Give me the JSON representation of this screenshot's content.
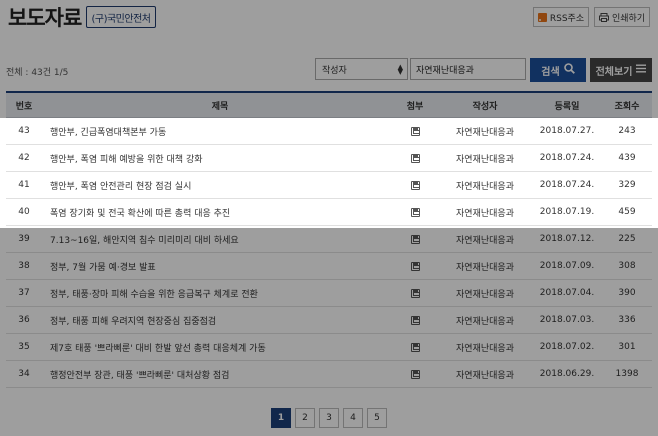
{
  "header": {
    "title": "보도자료",
    "org_button": "(구)국민안전처",
    "rss_label": "RSS주소",
    "print_label": "인쇄하기"
  },
  "toolbar": {
    "total_text": "전체 : 43건  1/5",
    "select_value": "작성자",
    "search_value": "자연재난대응과",
    "search_label": "검색",
    "viewall_label": "전체보기"
  },
  "table": {
    "headers": {
      "num": "번호",
      "title": "제목",
      "attachment": "첨부",
      "author": "작성자",
      "date": "등록일",
      "views": "조회수"
    },
    "rows": [
      {
        "num": "43",
        "title": "행안부, 긴급폭염대책본부 가동",
        "author": "자연재난대응과",
        "date": "2018.07.27.",
        "views": "243"
      },
      {
        "num": "42",
        "title": "행안부, 폭염 피해 예방을 위한 대책 강화",
        "author": "자연재난대응과",
        "date": "2018.07.24.",
        "views": "439"
      },
      {
        "num": "41",
        "title": "행안부, 폭염 안전관리 현장 점검 실시",
        "author": "자연재난대응과",
        "date": "2018.07.24.",
        "views": "329"
      },
      {
        "num": "40",
        "title": "폭염 장기화 및 전국 확산에 따른 총력 대응 추진",
        "author": "자연재난대응과",
        "date": "2018.07.19.",
        "views": "459"
      },
      {
        "num": "39",
        "title": "7.13~16일, 해안지역 침수 미리미리 대비 하세요",
        "author": "자연재난대응과",
        "date": "2018.07.12.",
        "views": "225"
      },
      {
        "num": "38",
        "title": "정부, 7월 가뭄 예·경보 발표",
        "author": "자연재난대응과",
        "date": "2018.07.09.",
        "views": "308"
      },
      {
        "num": "37",
        "title": "정부, 태풍·장마 피해 수습을 위한 응급복구 체계로 전환",
        "author": "자연재난대응과",
        "date": "2018.07.04.",
        "views": "390"
      },
      {
        "num": "36",
        "title": "정부, 태풍 피해 우려지역 현장중심 집중점검",
        "author": "자연재난대응과",
        "date": "2018.07.03.",
        "views": "336"
      },
      {
        "num": "35",
        "title": "제7호 태풍 '쁘라삐룬' 대비 한발 앞선 총력 대응체계 가동",
        "author": "자연재난대응과",
        "date": "2018.07.02.",
        "views": "301"
      },
      {
        "num": "34",
        "title": "행정안전부 장관, 태풍 '쁘라삐룬' 대처상황 점검",
        "author": "자연재난대응과",
        "date": "2018.06.29.",
        "views": "1398"
      }
    ]
  },
  "pagination": {
    "pages": [
      "1",
      "2",
      "3",
      "4",
      "5"
    ],
    "current": "1"
  }
}
